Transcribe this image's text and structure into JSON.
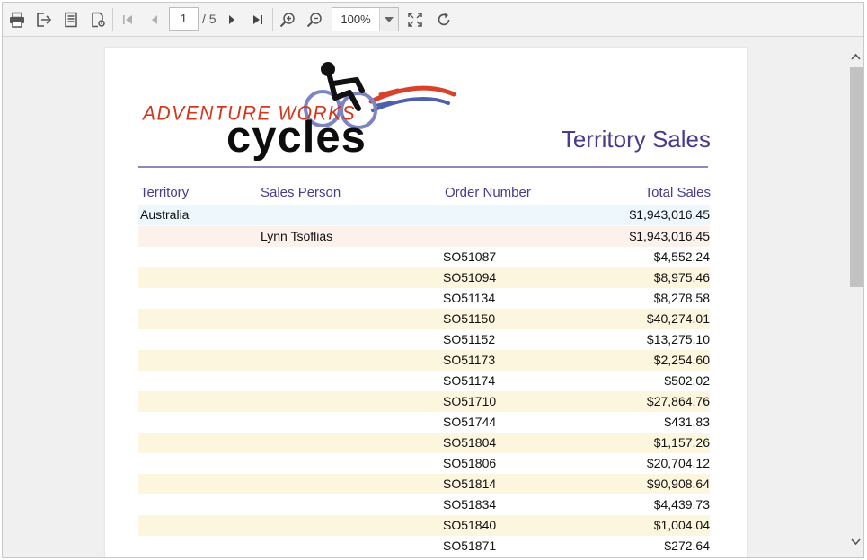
{
  "toolbar": {
    "print_icon": "printer-icon",
    "export_icon": "export-icon",
    "document_map_icon": "document-map-icon",
    "page_setup_icon": "page-setup-icon",
    "first_icon": "first-page-icon",
    "prev_icon": "previous-page-icon",
    "current_page": "1",
    "page_total": "/ 5",
    "next_icon": "next-page-icon",
    "last_icon": "last-page-icon",
    "zoom_in_icon": "zoom-in-icon",
    "zoom_out_icon": "zoom-out-icon",
    "zoom": "100%",
    "fit_icon": "fit-page-icon",
    "refresh_icon": "refresh-icon"
  },
  "report": {
    "logo_brand": "ADVENTURE WORKS",
    "logo_word": "cycles",
    "title": "Territory Sales",
    "columns": {
      "territory": "Territory",
      "sales_person": "Sales Person",
      "order_number": "Order Number",
      "total_sales": "Total Sales"
    },
    "territory": {
      "name": "Australia",
      "total": "$1,943,016.45"
    },
    "person": {
      "name": "Lynn Tsoflias",
      "total": "$1,943,016.45"
    },
    "orders": [
      {
        "number": "SO51087",
        "total": "$4,552.24"
      },
      {
        "number": "SO51094",
        "total": "$8,975.46"
      },
      {
        "number": "SO51134",
        "total": "$8,278.58"
      },
      {
        "number": "SO51150",
        "total": "$40,274.01"
      },
      {
        "number": "SO51152",
        "total": "$13,275.10"
      },
      {
        "number": "SO51173",
        "total": "$2,254.60"
      },
      {
        "number": "SO51174",
        "total": "$502.02"
      },
      {
        "number": "SO51710",
        "total": "$27,864.76"
      },
      {
        "number": "SO51744",
        "total": "$431.83"
      },
      {
        "number": "SO51804",
        "total": "$1,157.26"
      },
      {
        "number": "SO51806",
        "total": "$20,704.12"
      },
      {
        "number": "SO51814",
        "total": "$90,908.64"
      },
      {
        "number": "SO51834",
        "total": "$4,439.73"
      },
      {
        "number": "SO51840",
        "total": "$1,004.04"
      },
      {
        "number": "SO51871",
        "total": "$272.64"
      }
    ]
  },
  "colors": {
    "title": "#483d8b",
    "territory_row": "#eef7fc",
    "person_row": "#fdf1ec",
    "alt_row": "#fdf6de",
    "logo_red": "#d4361c"
  }
}
